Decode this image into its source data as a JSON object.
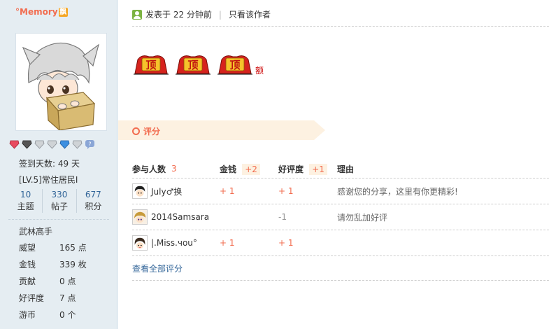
{
  "user": {
    "name": "°Memory",
    "name_badge": "飘",
    "checkin": "签到天数: 49 天",
    "level": "[LV.5]常住居民I",
    "stats": [
      {
        "num": "10",
        "label": "主题"
      },
      {
        "num": "330",
        "label": "帖子"
      },
      {
        "num": "677",
        "label": "积分"
      }
    ],
    "rank": "武林高手",
    "attributes": [
      {
        "label": "威望",
        "value": "165 点"
      },
      {
        "label": "金钱",
        "value": "339 枚"
      },
      {
        "label": "贡献",
        "value": "0 点"
      },
      {
        "label": "好评度",
        "value": "7 点"
      },
      {
        "label": "游币",
        "value": "0 个"
      }
    ]
  },
  "post": {
    "posted": "发表于 22 分钟前",
    "sep": "|",
    "author_only": "只看该作者",
    "ding_text": "顶",
    "ding_tail": "额"
  },
  "rating": {
    "title": "评分",
    "headers": {
      "participants": "参与人数",
      "participants_count": "3",
      "money": "金钱",
      "money_total": "+2",
      "praise": "好评度",
      "praise_total": "+1",
      "reason": "理由"
    },
    "rows": [
      {
        "user": "July♂换",
        "money": "+ 1",
        "praise": "+ 1",
        "reason": "感谢您的分享，这里有你更精彩!"
      },
      {
        "user": "2014Samsara",
        "money": "",
        "praise": "-1",
        "reason": "请勿乱加好评"
      },
      {
        "user": "|.Miss.чou°",
        "money": "+ 1",
        "praise": "+ 1",
        "reason": ""
      }
    ],
    "view_all": "查看全部评分"
  }
}
